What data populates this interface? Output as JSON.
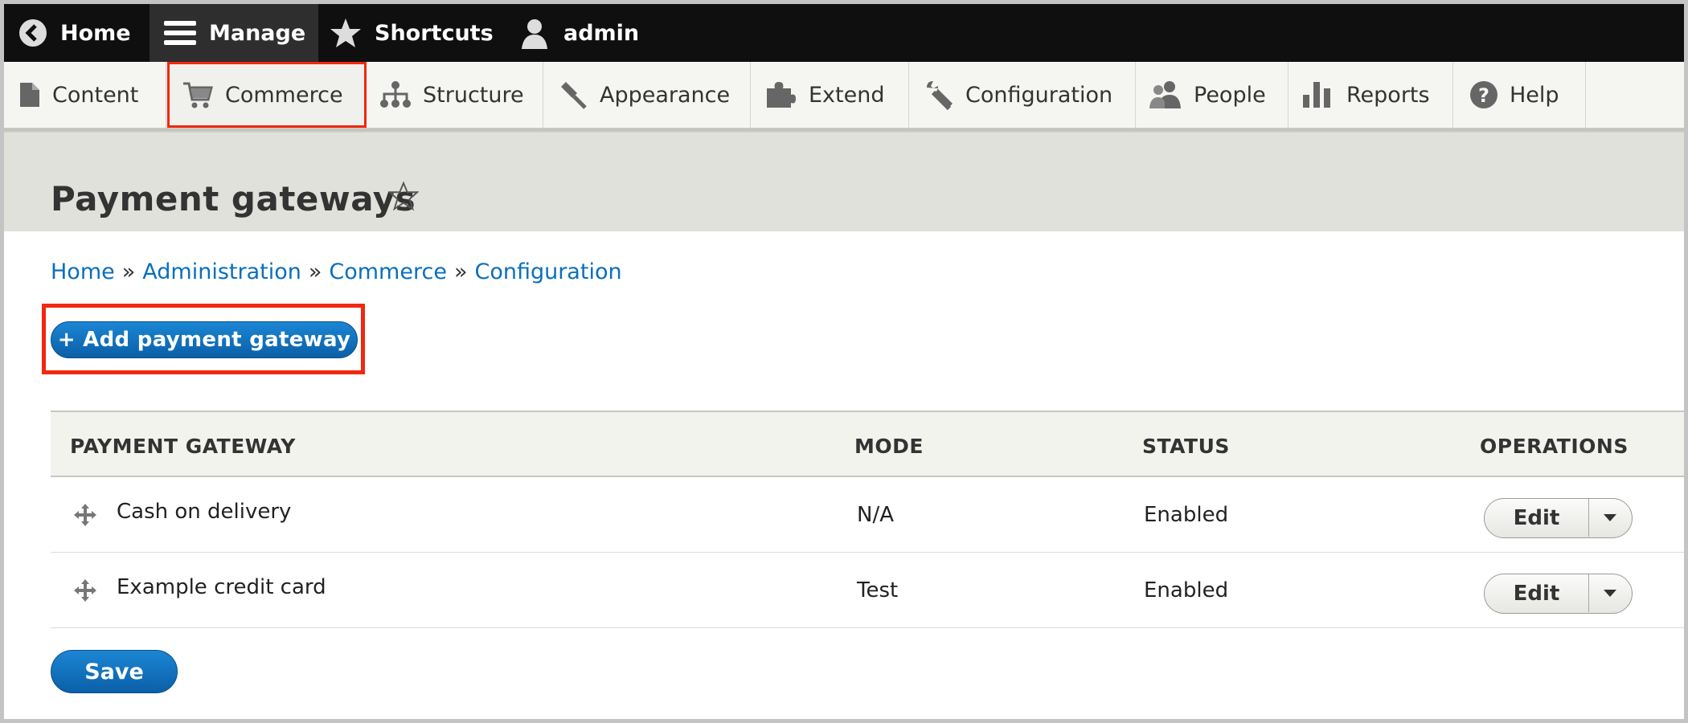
{
  "toolbar": {
    "home": "Home",
    "manage": "Manage",
    "shortcuts": "Shortcuts",
    "user": "admin"
  },
  "menu": {
    "items": [
      {
        "label": "Content",
        "icon": "content-icon"
      },
      {
        "label": "Commerce",
        "icon": "cart-icon"
      },
      {
        "label": "Structure",
        "icon": "structure-icon"
      },
      {
        "label": "Appearance",
        "icon": "appearance-icon"
      },
      {
        "label": "Extend",
        "icon": "puzzle-icon"
      },
      {
        "label": "Configuration",
        "icon": "wrench-icon"
      },
      {
        "label": "People",
        "icon": "people-icon"
      },
      {
        "label": "Reports",
        "icon": "reports-icon"
      },
      {
        "label": "Help",
        "icon": "help-icon"
      }
    ]
  },
  "page": {
    "title": "Payment gateways"
  },
  "breadcrumb": {
    "items": [
      "Home",
      "Administration",
      "Commerce",
      "Configuration"
    ],
    "separator": "»"
  },
  "actions": {
    "add_label": "+ Add payment gateway",
    "save_label": "Save"
  },
  "table": {
    "headers": [
      "PAYMENT GATEWAY",
      "MODE",
      "STATUS",
      "OPERATIONS"
    ],
    "rows": [
      {
        "name": "Cash on delivery",
        "mode": "N/A",
        "status": "Enabled",
        "op": "Edit"
      },
      {
        "name": "Example credit card",
        "mode": "Test",
        "status": "Enabled",
        "op": "Edit"
      }
    ]
  },
  "colors": {
    "link": "#0a6fbd",
    "primary_button": "#0b6fbe",
    "highlight": "#f0280f",
    "toolbar": "#0f0f0f"
  }
}
